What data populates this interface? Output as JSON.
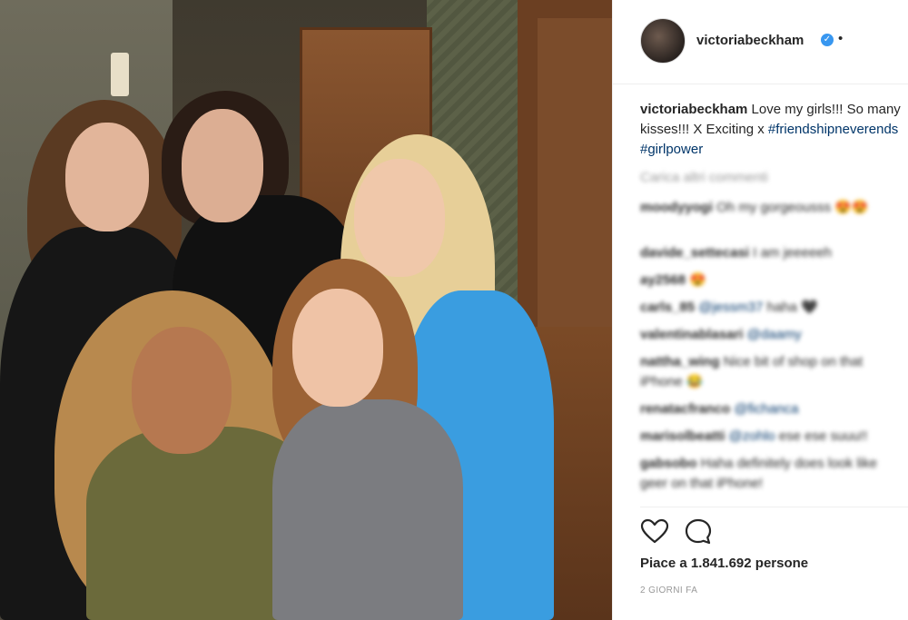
{
  "post": {
    "username": "victoriabeckham",
    "verified_glyph": "✓",
    "separator": "•",
    "caption": {
      "username": "victoriabeckham",
      "line1_text": " Love my girls!!! So many",
      "line2_text": "kisses!!! X Exciting x ",
      "hashtag1": "#friendshipneverends",
      "hashtag2": "#girlpower"
    },
    "load_more_label": "Carica altri commenti",
    "comments": [
      {
        "user": "moodyyogi",
        "text": " Oh my gorgeousss 😍😍"
      },
      {
        "user": "davide_settecasi",
        "text": " I am jeeeeeh"
      },
      {
        "user": "ay2568",
        "text": " 😍"
      },
      {
        "user": "carls_85",
        "mention": " @jessm37",
        "text": " haha 🖤"
      },
      {
        "user": "valentinablasari",
        "mention": " @daamy",
        "text": ""
      },
      {
        "user": "nattha_wing",
        "text": " Nice bit of shop on that",
        "text2": "iPhone 😂"
      },
      {
        "user": "renatacfranco",
        "mention": " @fichanca",
        "text": ""
      },
      {
        "user": "marisolbeatti",
        "mention": " @zohlo",
        "text": " ese ese suuu!!"
      },
      {
        "user": "gabsobo",
        "text": " Haha definitely does look like",
        "text2": "geer on that iPhone!"
      }
    ],
    "actions": {
      "like_icon": "heart-icon",
      "comment_icon": "comment-icon"
    },
    "likes_label": "Piace a 1.841.692 persone",
    "timestamp": "2 GIORNI FA"
  },
  "colors": {
    "accent_blue": "#3897f0",
    "hashtag_blue": "#003569",
    "muted_gray": "#999999",
    "text": "#262626"
  }
}
